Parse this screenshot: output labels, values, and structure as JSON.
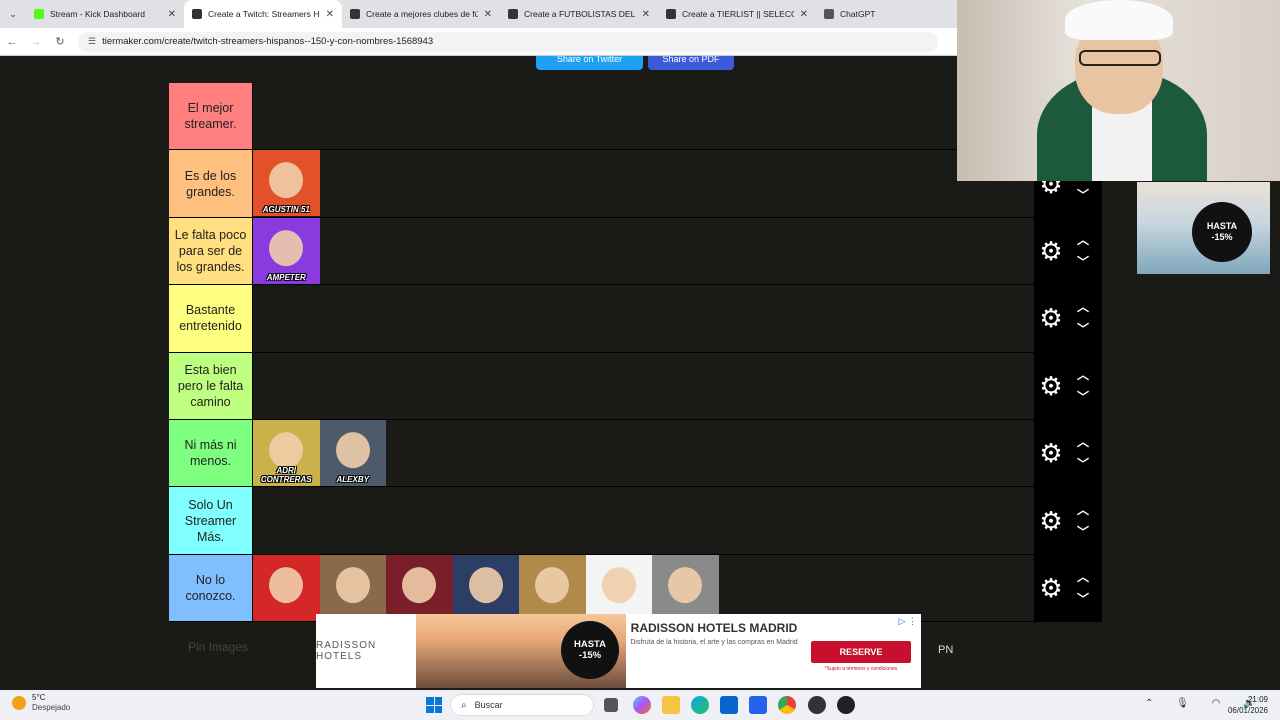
{
  "browser": {
    "tabs": [
      {
        "title": "Stream - Kick Dashboard",
        "color": "#53fc18",
        "active": false
      },
      {
        "title": "Create a Twitch: Streamers Hispanos",
        "color": "#333333",
        "active": true
      },
      {
        "title": "Create a mejores clubes de fútbol",
        "color": "#333333",
        "active": false
      },
      {
        "title": "Create a FUTBOLISTAS DEL SIGLO",
        "color": "#333333",
        "active": false
      },
      {
        "title": "Create a TIERLIST || SELECCIONES",
        "color": "#333333",
        "active": false
      },
      {
        "title": "ChatGPT",
        "color": "#555555",
        "active": false
      }
    ],
    "url": "tiermaker.com/create/twitch-streamers-hispanos--150-y-con-nombres-1568943"
  },
  "share_buttons": {
    "twitter": "Share on Twitter",
    "pdf": "Share on PDF"
  },
  "tiers": [
    {
      "label": "El mejor streamer.",
      "color": "#ff7f7f",
      "items": []
    },
    {
      "label": "Es de los grandes.",
      "color": "#ffbf7f",
      "items": [
        {
          "name": "AGUSTIN 51",
          "bg": "#e3512b"
        }
      ]
    },
    {
      "label": "Le falta poco para ser de los grandes.",
      "color": "#ffdf7f",
      "items": [
        {
          "name": "AMPETER",
          "bg": "#8a3be0"
        }
      ]
    },
    {
      "label": "Bastante entretenido",
      "color": "#ffff7f",
      "items": []
    },
    {
      "label": "Esta bien pero le falta camino",
      "color": "#bfff7f",
      "items": []
    },
    {
      "label": "Ni más ni menos.",
      "color": "#7fff7f",
      "items": [
        {
          "name": "ADRI CONTRERAS",
          "bg": "#c9b24a"
        },
        {
          "name": "ALEXBY",
          "bg": "#4d5a6a"
        }
      ]
    },
    {
      "label": "Solo Un Streamer Más.",
      "color": "#7fffff",
      "items": []
    },
    {
      "label": "No lo conozco.",
      "color": "#7fbfff",
      "items": [
        {
          "name": "",
          "bg": "#d42828"
        },
        {
          "name": "",
          "bg": "#8a6a4a"
        },
        {
          "name": "",
          "bg": "#7a1f2a"
        },
        {
          "name": "",
          "bg": "#2c3e63"
        },
        {
          "name": "",
          "bg": "#b08a4a"
        },
        {
          "name": "",
          "bg": "#f4f4f4"
        },
        {
          "name": "",
          "bg": "#8a8a8a"
        }
      ]
    }
  ],
  "page_footer": {
    "pin_images": "Pin Images",
    "pn": "PN"
  },
  "ad_banner": {
    "logo": "RADISSON HOTELS",
    "badge_line1": "HASTA",
    "badge_line2": "-15%",
    "title": "RADISSON HOTELS MADRID",
    "desc": "Disfruta de la historia, el arte y las compras en Madrid",
    "cta": "RESERVE",
    "terms": "*Sujeto a términos y condiciones"
  },
  "side_ad": {
    "badge_line1": "HASTA",
    "badge_line2": "-15%"
  },
  "taskbar": {
    "temperature": "5°C",
    "weather": "Despejado",
    "search_placeholder": "Buscar",
    "time": "21:09",
    "date": "06/01/2026"
  }
}
